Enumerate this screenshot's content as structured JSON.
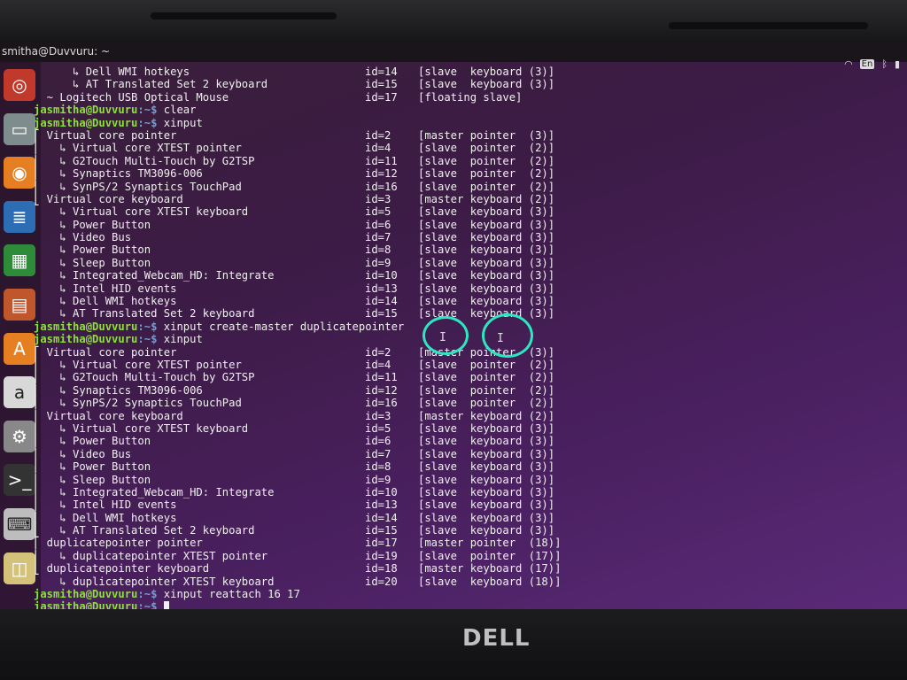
{
  "window": {
    "title": "smitha@Duvvuru: ~"
  },
  "tray": {
    "lang": "En"
  },
  "launcher": {
    "icons": [
      "search-icon",
      "files-icon",
      "firefox-icon",
      "writer-icon",
      "calc-icon",
      "impress-icon",
      "software-center-icon",
      "amazon-icon",
      "settings-icon",
      "terminal-icon",
      "keyboard-icon",
      "image-viewer-icon"
    ]
  },
  "bezel": {
    "brand": "DELL"
  },
  "terminal": {
    "lines": [
      {
        "name": "      ↳ Dell WMI hotkeys",
        "id": "id=14",
        "role": "[slave  keyboard (3)]"
      },
      {
        "name": "      ↳ AT Translated Set 2 keyboard",
        "id": "id=15",
        "role": "[slave  keyboard (3)]"
      },
      {
        "name": "  ~ Logitech USB Optical Mouse",
        "id": "id=17",
        "role": "[floating slave]"
      },
      {
        "prompt": "jasmitha@Duvvuru",
        "path": ":~$ ",
        "cmd": "clear"
      },
      {
        "prompt": "jasmitha@Duvvuru",
        "path": ":~$ ",
        "cmd": "xinput"
      },
      {
        "name": "⎡ Virtual core pointer",
        "id": "id=2",
        "role": "[master pointer  (3)]"
      },
      {
        "name": "⎜   ↳ Virtual core XTEST pointer",
        "id": "id=4",
        "role": "[slave  pointer  (2)]"
      },
      {
        "name": "⎜   ↳ G2Touch Multi-Touch by G2TSP",
        "id": "id=11",
        "role": "[slave  pointer  (2)]"
      },
      {
        "name": "⎜   ↳ Synaptics TM3096-006",
        "id": "id=12",
        "role": "[slave  pointer  (2)]"
      },
      {
        "name": "⎜   ↳ SynPS/2 Synaptics TouchPad",
        "id": "id=16",
        "role": "[slave  pointer  (2)]"
      },
      {
        "name": "⎣ Virtual core keyboard",
        "id": "id=3",
        "role": "[master keyboard (2)]"
      },
      {
        "name": "    ↳ Virtual core XTEST keyboard",
        "id": "id=5",
        "role": "[slave  keyboard (3)]"
      },
      {
        "name": "    ↳ Power Button",
        "id": "id=6",
        "role": "[slave  keyboard (3)]"
      },
      {
        "name": "    ↳ Video Bus",
        "id": "id=7",
        "role": "[slave  keyboard (3)]"
      },
      {
        "name": "    ↳ Power Button",
        "id": "id=8",
        "role": "[slave  keyboard (3)]"
      },
      {
        "name": "    ↳ Sleep Button",
        "id": "id=9",
        "role": "[slave  keyboard (3)]"
      },
      {
        "name": "    ↳ Integrated_Webcam_HD: Integrate",
        "id": "id=10",
        "role": "[slave  keyboard (3)]"
      },
      {
        "name": "    ↳ Intel HID events",
        "id": "id=13",
        "role": "[slave  keyboard (3)]"
      },
      {
        "name": "    ↳ Dell WMI hotkeys",
        "id": "id=14",
        "role": "[slave  keyboard (3)]"
      },
      {
        "name": "    ↳ AT Translated Set 2 keyboard",
        "id": "id=15",
        "role": "[slave  keyboard (3)]"
      },
      {
        "prompt": "jasmitha@Duvvuru",
        "path": ":~$ ",
        "cmd": "xinput create-master duplicatepointer"
      },
      {
        "prompt": "jasmitha@Duvvuru",
        "path": ":~$ ",
        "cmd": "xinput"
      },
      {
        "name": "⎡ Virtual core pointer",
        "id": "id=2",
        "role": "[master pointer  (3)]"
      },
      {
        "name": "⎜   ↳ Virtual core XTEST pointer",
        "id": "id=4",
        "role": "[slave  pointer  (2)]"
      },
      {
        "name": "⎜   ↳ G2Touch Multi-Touch by G2TSP",
        "id": "id=11",
        "role": "[slave  pointer  (2)]"
      },
      {
        "name": "⎜   ↳ Synaptics TM3096-006",
        "id": "id=12",
        "role": "[slave  pointer  (2)]"
      },
      {
        "name": "⎜   ↳ SynPS/2 Synaptics TouchPad",
        "id": "id=16",
        "role": "[slave  pointer  (2)]"
      },
      {
        "name": "⎜ Virtual core keyboard",
        "id": "id=3",
        "role": "[master keyboard (2)]"
      },
      {
        "name": "⎜   ↳ Virtual core XTEST keyboard",
        "id": "id=5",
        "role": "[slave  keyboard (3)]"
      },
      {
        "name": "⎜   ↳ Power Button",
        "id": "id=6",
        "role": "[slave  keyboard (3)]"
      },
      {
        "name": "⎜   ↳ Video Bus",
        "id": "id=7",
        "role": "[slave  keyboard (3)]"
      },
      {
        "name": "⎜   ↳ Power Button",
        "id": "id=8",
        "role": "[slave  keyboard (3)]"
      },
      {
        "name": "⎜   ↳ Sleep Button",
        "id": "id=9",
        "role": "[slave  keyboard (3)]"
      },
      {
        "name": "⎜   ↳ Integrated_Webcam_HD: Integrate",
        "id": "id=10",
        "role": "[slave  keyboard (3)]"
      },
      {
        "name": "⎜   ↳ Intel HID events",
        "id": "id=13",
        "role": "[slave  keyboard (3)]"
      },
      {
        "name": "⎜   ↳ Dell WMI hotkeys",
        "id": "id=14",
        "role": "[slave  keyboard (3)]"
      },
      {
        "name": "⎜   ↳ AT Translated Set 2 keyboard",
        "id": "id=15",
        "role": "[slave  keyboard (3)]"
      },
      {
        "name": "⎡ duplicatepointer pointer",
        "id": "id=17",
        "role": "[master pointer  (18)]"
      },
      {
        "name": "⎜   ↳ duplicatepointer XTEST pointer",
        "id": "id=19",
        "role": "[slave  pointer  (17)]"
      },
      {
        "name": "⎣ duplicatepointer keyboard",
        "id": "id=18",
        "role": "[master keyboard (17)]"
      },
      {
        "name": "    ↳ duplicatepointer XTEST keyboard",
        "id": "id=20",
        "role": "[slave  keyboard (18)]"
      },
      {
        "prompt": "jasmitha@Duvvuru",
        "path": ":~$ ",
        "cmd": "xinput reattach 16 17"
      },
      {
        "prompt": "jasmitha@Duvvuru",
        "path": ":~$ ",
        "cmd": "",
        "cursor": true
      }
    ]
  },
  "annotations": {
    "ibeam": "I"
  }
}
